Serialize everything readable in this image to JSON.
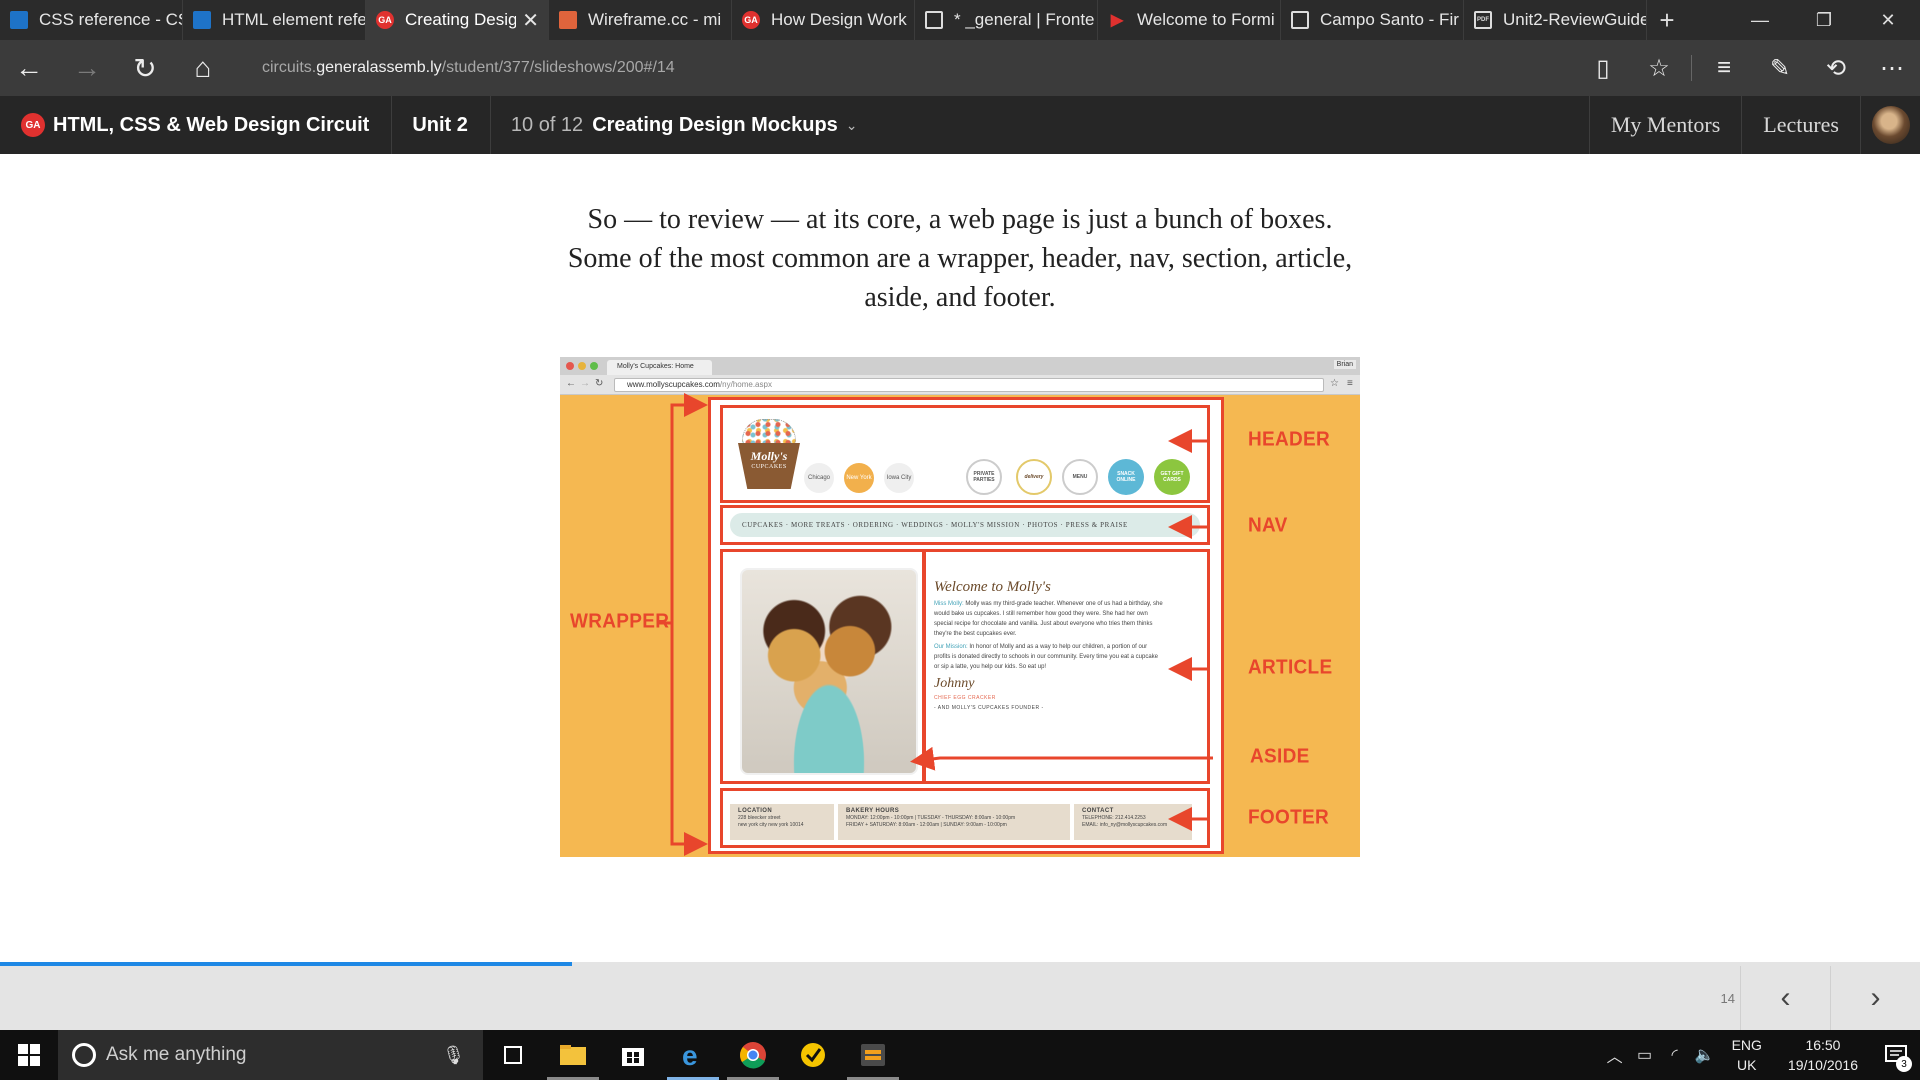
{
  "browser": {
    "tabs": [
      {
        "title": "CSS reference - CS",
        "icon": "blue-doc-icon",
        "active": false
      },
      {
        "title": "HTML element refe",
        "icon": "blue-doc-icon",
        "active": false
      },
      {
        "title": "Creating Desig",
        "icon": "ga-logo-icon",
        "active": true
      },
      {
        "title": "Wireframe.cc - mi",
        "icon": "wireframe-icon",
        "active": false
      },
      {
        "title": "How Design Work",
        "icon": "ga-logo-icon",
        "active": false
      },
      {
        "title": "* _general | Fronte",
        "icon": "window-icon",
        "active": false
      },
      {
        "title": "Welcome to Formi",
        "icon": "formidable-icon",
        "active": false
      },
      {
        "title": "Campo Santo - Fir",
        "icon": "window-icon",
        "active": false
      },
      {
        "title": "Unit2-ReviewGuide",
        "icon": "pdf-icon",
        "active": false
      }
    ],
    "url_prefix": "circuits.",
    "url_host": "generalassemb.ly",
    "url_path": "/student/377/slideshows/200#/14"
  },
  "site": {
    "logo_text": "GA",
    "course": "HTML, CSS & Web Design Circuit",
    "unit": "Unit 2",
    "progress": "10 of 12",
    "lesson": "Creating Design Mockups",
    "nav": [
      "My Mentors",
      "Lectures"
    ]
  },
  "slide": {
    "text": "So — to review — at its core, a web page is just a bunch of boxes. Some of the most common are a wrapper, header, nav, section, article, aside, and footer.",
    "number": "14",
    "progress_fraction": 0.298
  },
  "figure": {
    "browser_tab": "Molly's Cupcakes: Home",
    "browser_user": "Brian",
    "url_host": "www.mollyscupcakes.com",
    "url_path": "/ny/home.aspx",
    "labels": {
      "header": "HEADER",
      "nav": "NAV",
      "wrapper": "WRAPPER",
      "article": "ARTICLE",
      "aside": "ASIDE",
      "footer": "FOOTER"
    },
    "logo_name": "Molly's",
    "logo_sub": "CUPCAKES",
    "cities": [
      "Chicago",
      "New York",
      "Iowa City"
    ],
    "badges": [
      "PRIVATE PARTIES",
      "delivery",
      "MENU",
      "SNACK ONLINE",
      "GET GIFT CARDS"
    ],
    "nav_text": "CUPCAKES · MORE TREATS · ORDERING · WEDDINGS · MOLLY'S MISSION · PHOTOS · PRESS & PRAISE",
    "article": {
      "welcome": "Welcome to Molly's",
      "p1_lead": "Miss Molly:",
      "p1": " Molly was my third-grade teacher. Whenever one of us had a birthday, she would bake us cupcakes. I still remember how good they were. She had her own special recipe for chocolate and vanilla. Just about everyone who tries them thinks they're the best cupcakes ever.",
      "p2_lead": "Our Mission:",
      "p2": " In honor of Molly and as a way to help our children, a portion of our profits is donated directly to schools in our community. Every time you eat a cupcake or sip a latte, you help our kids. So eat up!",
      "signature": "Johnny",
      "sig_title": "CHIEF EGG CRACKER",
      "sig_sub": "- AND MOLLY'S CUPCAKES FOUNDER -"
    },
    "footer": {
      "location_h": "LOCATION",
      "location_1": "228 bleecker street",
      "location_2": "new york city new york 10014",
      "hours_h": "BAKERY HOURS",
      "hours_1": "MONDAY: 12:00pm - 10:00pm | TUESDAY - THURSDAY: 8:00am - 10:00pm",
      "hours_2": "FRIDAY + SATURDAY: 8:00am - 12:00am | SUNDAY: 9:00am - 10:00pm",
      "contact_h": "CONTACT",
      "contact_1": "TELEPHONE: 212.414.2253",
      "contact_2": "EMAIL: info_ny@mollyscupcakes.com"
    }
  },
  "taskbar": {
    "search_placeholder": "Ask me anything",
    "lang_1": "ENG",
    "lang_2": "UK",
    "time": "16:50",
    "date": "19/10/2016",
    "notifications": "3"
  },
  "colors": {
    "accent": "#e8462c",
    "figure_bg": "#f5b851",
    "ga_red": "#e0312f",
    "progress": "#1e88e5"
  }
}
